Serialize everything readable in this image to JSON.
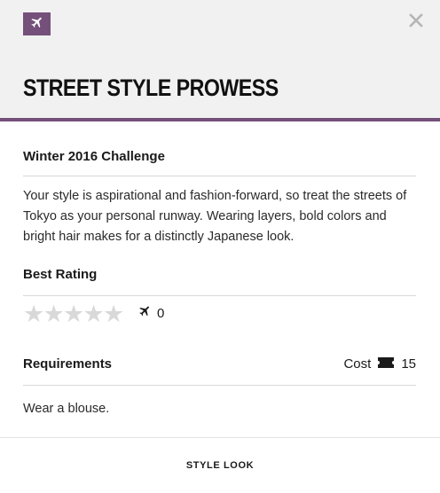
{
  "header": {
    "badge_icon": "airplane-icon",
    "close_icon": "close-icon",
    "title": "STREET STYLE PROWESS",
    "accent_color": "#75507b"
  },
  "challenge": {
    "title": "Winter 2016 Challenge",
    "description": "Your style is aspirational and fashion-forward, so treat the streets of Tokyo as your personal runway. Wearing layers, bold colors and bright hair makes for a distinctly Japanese look."
  },
  "rating": {
    "title": "Best Rating",
    "stars_filled": 0,
    "stars_total": 5,
    "plays_icon": "airplane-icon",
    "plays_count": "0"
  },
  "requirements": {
    "title": "Requirements",
    "cost_label": "Cost",
    "cost_icon": "ticket-icon",
    "cost_value": "15",
    "items": [
      "Wear a blouse."
    ]
  },
  "footer": {
    "button_label": "STYLE LOOK"
  }
}
